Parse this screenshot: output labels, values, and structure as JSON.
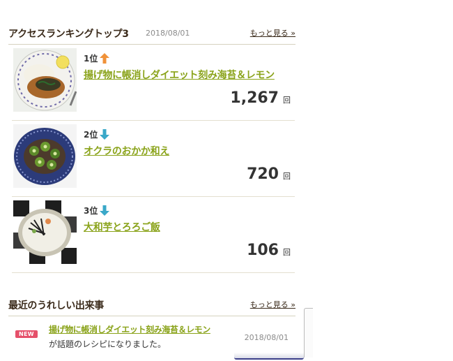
{
  "ranking": {
    "title": "アクセスランキングトップ3",
    "date": "2018/08/01",
    "more_label": "もっと見る »",
    "items": [
      {
        "rank": "1位",
        "trend": "up",
        "title": "揚げ物に帳消しダイエット刻み海苔＆レモン",
        "count": "1,267",
        "unit": "回"
      },
      {
        "rank": "2位",
        "trend": "down",
        "title": "オクラのおかか和え",
        "count": "720",
        "unit": "回"
      },
      {
        "rank": "3位",
        "trend": "down",
        "title": "大和芋とろろご飯",
        "count": "106",
        "unit": "回"
      }
    ]
  },
  "news": {
    "title": "最近のうれしい出来事",
    "more_label": "もっと見る »",
    "items": [
      {
        "badge": "NEW",
        "link": "揚げ物に帳消しダイエット刻み海苔＆レモン",
        "text": "が話題のレシピになりました。",
        "date": "2018/08/01"
      }
    ]
  },
  "colors": {
    "link": "#8aa31a",
    "up_arrow": "#f0923a",
    "down_arrow": "#3aa8c8",
    "badge": "#e5506a"
  }
}
